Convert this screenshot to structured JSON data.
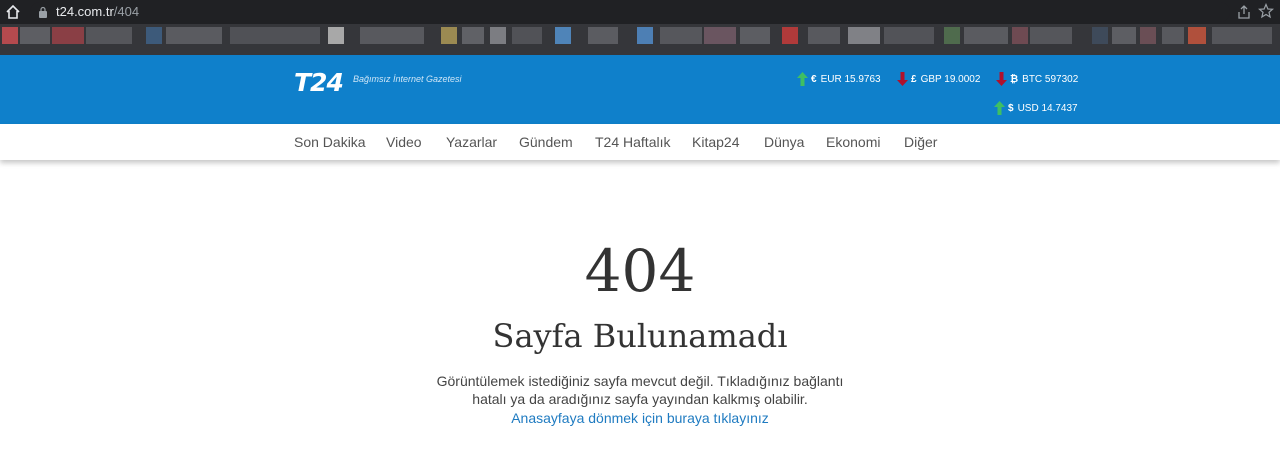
{
  "browser": {
    "url_host": "t24.com.tr",
    "url_path": "/404"
  },
  "header": {
    "logo": "T24",
    "tagline": "Bağımsız İnternet Gazetesi",
    "rates": [
      {
        "symbol": "€",
        "label": "EUR 15.9763",
        "trend": "up"
      },
      {
        "symbol": "£",
        "label": "GBP 19.0002",
        "trend": "down"
      },
      {
        "symbol": "₿",
        "label": "BTC 597302",
        "trend": "down"
      },
      {
        "symbol": "$",
        "label": "USD 14.7437",
        "trend": "up"
      }
    ]
  },
  "nav": {
    "items": [
      "Son Dakika",
      "Video",
      "Yazarlar",
      "Gündem",
      "T24 Haftalık",
      "Kitap24",
      "Dünya",
      "Ekonomi",
      "Diğer"
    ]
  },
  "error": {
    "code": "404",
    "title": "Sayfa Bulunamadı",
    "description": "Görüntülemek istediğiniz sayfa mevcut değil. Tıkladığınız bağlantı hatalı ya da aradığınız sayfa yayından kalkmış olabilir.",
    "home_link": "Anasayfaya dönmek için buraya tıklayınız"
  },
  "colors": {
    "brand_blue": "#0f80cb",
    "up_arrow": "#3fbf62",
    "down_arrow": "#b0112c",
    "link": "#1f7bc1"
  }
}
